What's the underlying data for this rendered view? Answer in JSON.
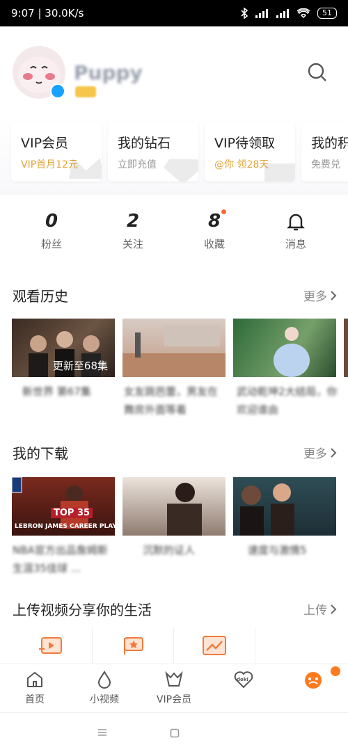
{
  "status": {
    "time_speed": "9:07 | 30.0K/s",
    "battery": "51"
  },
  "user": {
    "name": "Puppy"
  },
  "cards": [
    {
      "title": "VIP会员",
      "sub": "VIP首月12元",
      "sub_style": "gold"
    },
    {
      "title": "我的钻石",
      "sub": "立即充值",
      "sub_style": "gray"
    },
    {
      "title": "VIP待领取",
      "sub": "@你 领28天",
      "sub_style": "gold"
    },
    {
      "title": "我的积",
      "sub": "免费兑",
      "sub_style": "gray"
    }
  ],
  "stats": [
    {
      "value": "0",
      "label": "粉丝"
    },
    {
      "value": "2",
      "label": "关注"
    },
    {
      "value": "8",
      "label": "收藏"
    },
    {
      "value": "",
      "label": "消息"
    }
  ],
  "history": {
    "title": "观看历史",
    "more": "更多",
    "items": [
      {
        "overlay": "更新至68集",
        "caption": "新世界 第67集"
      },
      {
        "overlay": "",
        "caption": "女友跳芭蕾，男友在舞房外面等着"
      },
      {
        "overlay": "",
        "caption": "武动乾坤2大结局，你欢迎谁由"
      }
    ]
  },
  "downloads": {
    "title": "我的下载",
    "more": "更多",
    "items": [
      {
        "thumb_text_1": "TOP 35",
        "thumb_text_2": "LEBRON JAMES CAREER PLAYS",
        "caption": "NBA官方出品詹姆斯生涯35佳球 ..."
      },
      {
        "caption": "沉默的证人"
      },
      {
        "caption": "速度与激情5"
      }
    ]
  },
  "upload": {
    "title": "上传视频分享你的生活",
    "action": "上传"
  },
  "tabs": [
    {
      "label": "首页"
    },
    {
      "label": "小视频"
    },
    {
      "label": "VIP会员"
    },
    {
      "label": "",
      "icon": "doki-icon"
    },
    {
      "label": "",
      "icon": "profile-face-icon"
    }
  ],
  "tab_doki_text": "doki",
  "colors": {
    "accent_orange": "#ff6a33",
    "gold": "#e2a53a",
    "active_tab": "#ff7a1f"
  }
}
